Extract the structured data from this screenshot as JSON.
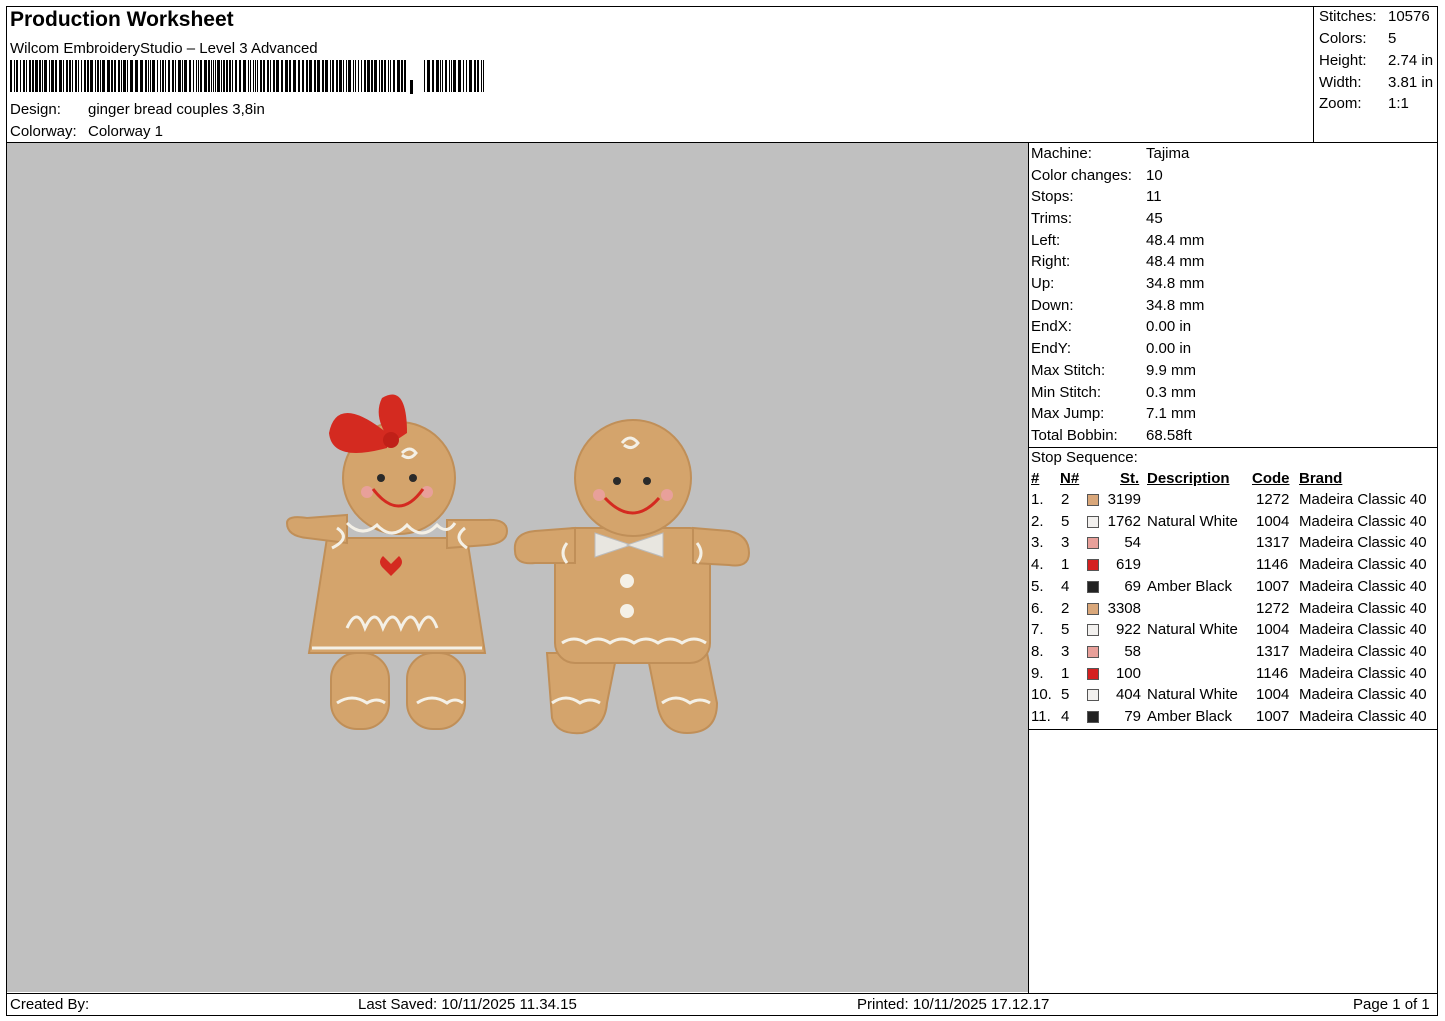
{
  "header": {
    "title": "Production Worksheet",
    "software": "Wilcom EmbroideryStudio – Level 3 Advanced",
    "design_label": "Design:",
    "design_value": "ginger bread couples 3,8in",
    "colorway_label": "Colorway:",
    "colorway_value": "Colorway 1"
  },
  "summary": [
    {
      "label": "Stitches:",
      "value": "10576"
    },
    {
      "label": "Colors:",
      "value": "5"
    },
    {
      "label": "Height:",
      "value": "2.74 in"
    },
    {
      "label": "Width:",
      "value": "3.81 in"
    },
    {
      "label": "Zoom:",
      "value": "1:1"
    }
  ],
  "machine_info": [
    {
      "label": "Machine:",
      "value": "Tajima"
    },
    {
      "label": "Color changes:",
      "value": "10"
    },
    {
      "label": "Stops:",
      "value": "11"
    },
    {
      "label": "Trims:",
      "value": "45"
    },
    {
      "label": "Left:",
      "value": "48.4 mm"
    },
    {
      "label": "Right:",
      "value": "48.4 mm"
    },
    {
      "label": "Up:",
      "value": "34.8 mm"
    },
    {
      "label": "Down:",
      "value": "34.8 mm"
    },
    {
      "label": "EndX:",
      "value": "0.00 in"
    },
    {
      "label": "EndY:",
      "value": "0.00 in"
    },
    {
      "label": "Max Stitch:",
      "value": "9.9 mm"
    },
    {
      "label": "Min Stitch:",
      "value": "0.3 mm"
    },
    {
      "label": "Max Jump:",
      "value": "7.1 mm"
    },
    {
      "label": "Total Bobbin:",
      "value": "68.58ft"
    }
  ],
  "stop_sequence": {
    "title": "Stop Sequence:",
    "headers": {
      "num": "#",
      "n": "N#",
      "st": "St.",
      "desc": "Description",
      "code": "Code",
      "brand": "Brand"
    },
    "rows": [
      {
        "idx": "1.",
        "n": "2",
        "color": "#d9a77a",
        "st": "3199",
        "desc": "",
        "code": "1272",
        "brand": "Madeira Classic 40"
      },
      {
        "idx": "2.",
        "n": "5",
        "color": "#f2f0ee",
        "st": "1762",
        "desc": "Natural White",
        "code": "1004",
        "brand": "Madeira Classic 40"
      },
      {
        "idx": "3.",
        "n": "3",
        "color": "#e8a09a",
        "st": "54",
        "desc": "",
        "code": "1317",
        "brand": "Madeira Classic 40"
      },
      {
        "idx": "4.",
        "n": "1",
        "color": "#d42020",
        "st": "619",
        "desc": "",
        "code": "1146",
        "brand": "Madeira Classic 40"
      },
      {
        "idx": "5.",
        "n": "4",
        "color": "#222222",
        "st": "69",
        "desc": "Amber Black",
        "code": "1007",
        "brand": "Madeira Classic 40"
      },
      {
        "idx": "6.",
        "n": "2",
        "color": "#d9a77a",
        "st": "3308",
        "desc": "",
        "code": "1272",
        "brand": "Madeira Classic 40"
      },
      {
        "idx": "7.",
        "n": "5",
        "color": "#f2f0ee",
        "st": "922",
        "desc": "Natural White",
        "code": "1004",
        "brand": "Madeira Classic 40"
      },
      {
        "idx": "8.",
        "n": "3",
        "color": "#e8a09a",
        "st": "58",
        "desc": "",
        "code": "1317",
        "brand": "Madeira Classic 40"
      },
      {
        "idx": "9.",
        "n": "1",
        "color": "#d42020",
        "st": "100",
        "desc": "",
        "code": "1146",
        "brand": "Madeira Classic 40"
      },
      {
        "idx": "10.",
        "n": "5",
        "color": "#f2f0ee",
        "st": "404",
        "desc": "Natural White",
        "code": "1004",
        "brand": "Madeira Classic 40"
      },
      {
        "idx": "11.",
        "n": "4",
        "color": "#222222",
        "st": "79",
        "desc": "Amber Black",
        "code": "1007",
        "brand": "Madeira Classic 40"
      }
    ]
  },
  "footer": {
    "created_by": "Created By:",
    "last_saved": "Last Saved: 10/11/2025 11.34.15",
    "printed": "Printed: 10/11/2025 17.12.17",
    "page": "Page 1 of 1"
  },
  "design_colors": {
    "canvas": "#c0c0c0",
    "cookie": "#d4a46c",
    "icing": "#f4f0e6",
    "red": "#d42a20",
    "blush": "#e8a09a",
    "black": "#2a2a2a"
  }
}
